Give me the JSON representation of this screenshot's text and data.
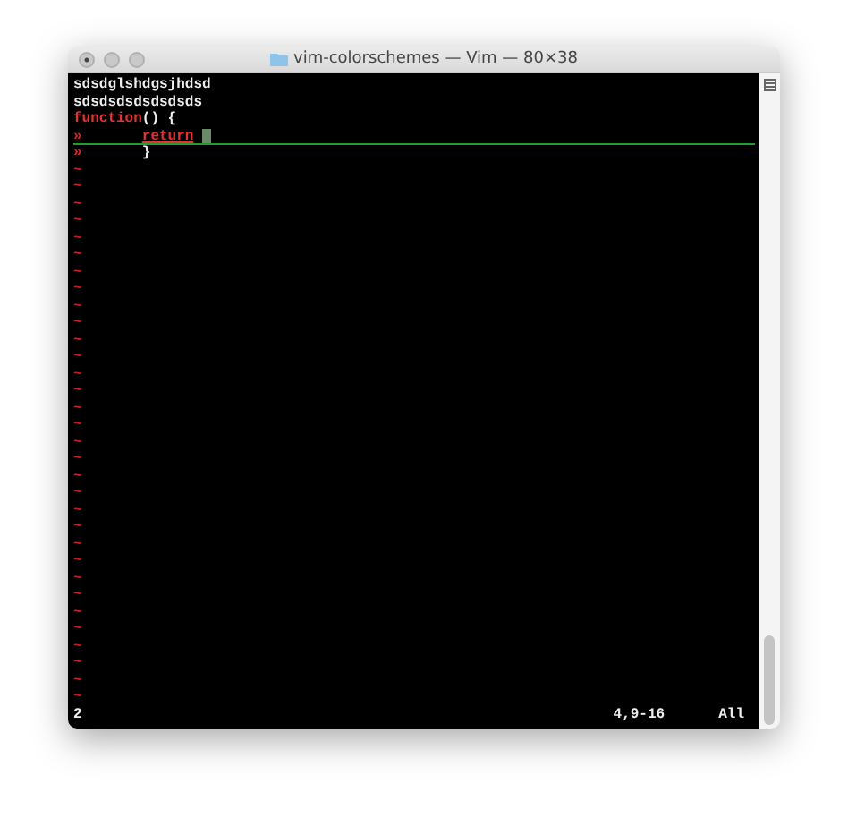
{
  "window": {
    "title": "vim-colorschemes — Vim — 80×38"
  },
  "buffer": {
    "lines": [
      {
        "segments": [
          {
            "text": "sdsdglshdgsjhdsd",
            "kind": "plain"
          }
        ],
        "cursorline": false,
        "cursor": false
      },
      {
        "segments": [
          {
            "text": "sdsdsdsdsdsdsds",
            "kind": "plain"
          }
        ],
        "cursorline": false,
        "cursor": false
      },
      {
        "segments": [
          {
            "text": "function",
            "kind": "keyword"
          },
          {
            "text": "() {",
            "kind": "plain"
          }
        ],
        "cursorline": false,
        "cursor": false
      },
      {
        "listchar": "»",
        "segments": [
          {
            "text": "return",
            "kind": "keyword"
          }
        ],
        "cursorline": true,
        "cursor": true
      },
      {
        "listchar": "»",
        "segments": [
          {
            "text": "}",
            "kind": "plain"
          }
        ],
        "cursorline": false,
        "cursor": false
      }
    ],
    "filler": [
      "~",
      "~",
      "~",
      "~",
      "~",
      "~",
      "~",
      "~",
      "~",
      "~",
      "~",
      "~",
      "~",
      "~",
      "~",
      "~",
      "~",
      "~",
      "~",
      "~",
      "~",
      "~",
      "~",
      "~",
      "~",
      "~",
      "~",
      "~",
      "~",
      "~",
      "~",
      "~"
    ]
  },
  "command_line": {
    "message": "2",
    "position": "4,9-16",
    "scroll": "All"
  }
}
